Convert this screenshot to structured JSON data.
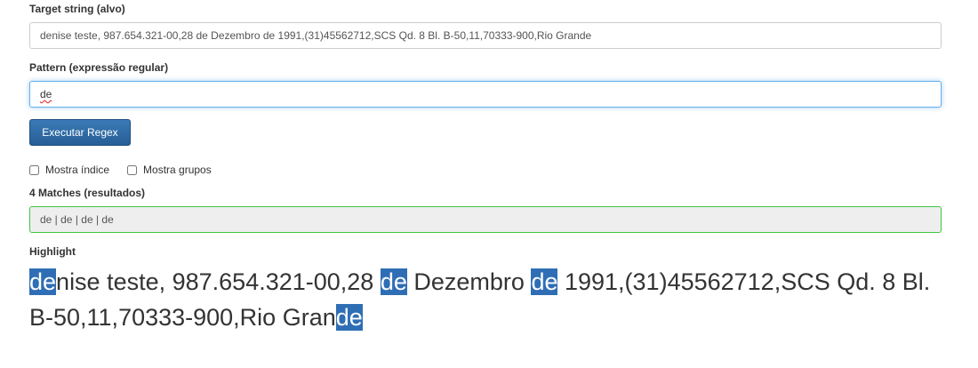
{
  "target": {
    "label": "Target string (alvo)",
    "value": "denise teste, 987.654.321-00,28 de Dezembro de 1991,(31)45562712,SCS Qd. 8 Bl. B-50,11,70333-900,Rio Grande"
  },
  "pattern": {
    "label": "Pattern (expressão regular)",
    "value": "de"
  },
  "run_button": {
    "label": "Executar Regex"
  },
  "options": {
    "show_index": "Mostra índice",
    "show_groups": "Mostra grupos"
  },
  "matches": {
    "label": "4 Matches (resultados)",
    "value": "de | de | de | de"
  },
  "highlight": {
    "label": "Highlight",
    "segments": [
      {
        "text": "de",
        "match": true
      },
      {
        "text": "nise teste, 987.654.321-00,28 ",
        "match": false
      },
      {
        "text": "de",
        "match": true
      },
      {
        "text": " Dezembro ",
        "match": false
      },
      {
        "text": "de",
        "match": true
      },
      {
        "text": " 1991,(31)45562712,SCS Qd. 8 Bl. B-50,11,70333-900,Rio Gran",
        "match": false
      },
      {
        "text": "de",
        "match": true
      }
    ]
  },
  "colors": {
    "highlight_bg": "#2f6eb5",
    "button_bg": "#337ab7",
    "focus_border": "#66afe9",
    "success_border": "#3fc63f"
  }
}
